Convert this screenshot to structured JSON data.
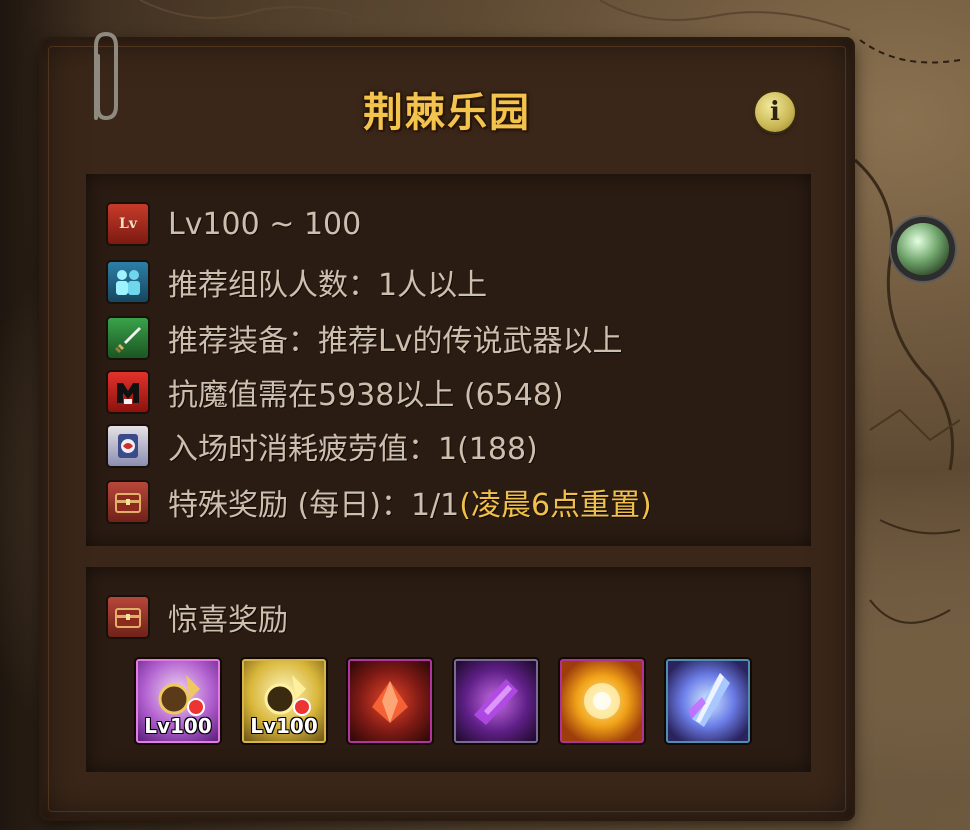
{
  "dungeon": {
    "title": "荆棘乐园",
    "info_icon": "info-icon",
    "info_glyph": "i"
  },
  "details": [
    {
      "icon": "level-icon",
      "icon_text": "Lv",
      "text": "Lv100 ~ 100"
    },
    {
      "icon": "party-icon",
      "text": "推荐组队人数：1人以上"
    },
    {
      "icon": "sword-icon",
      "text": "推荐装备：推荐Lv的传说武器以上"
    },
    {
      "icon": "anti-magic-icon",
      "text": "抗魔值需在5938以上 (6548)"
    },
    {
      "icon": "fatigue-icon",
      "text": "入场时消耗疲劳值：1(188)"
    },
    {
      "icon": "chest-icon",
      "text": "特殊奖励 (每日)：1/1",
      "note": "(凌晨6点重置)"
    }
  ],
  "surprise": {
    "icon": "chest-icon",
    "label": "惊喜奖励",
    "rewards": [
      {
        "icon": "gear-box-icon",
        "label": "Lv100"
      },
      {
        "icon": "gear-box-icon",
        "label": "Lv100"
      },
      {
        "icon": "red-crystal-icon",
        "label": ""
      },
      {
        "icon": "purple-crystal-icon",
        "label": ""
      },
      {
        "icon": "golden-orb-icon",
        "label": ""
      },
      {
        "icon": "blue-crystal-icon",
        "label": ""
      }
    ]
  },
  "colors": {
    "title": "#f3c44d",
    "text": "#cdbfae",
    "highlight": "#f0c04a",
    "panel": "#3b2719",
    "box": "#2b1c13"
  }
}
